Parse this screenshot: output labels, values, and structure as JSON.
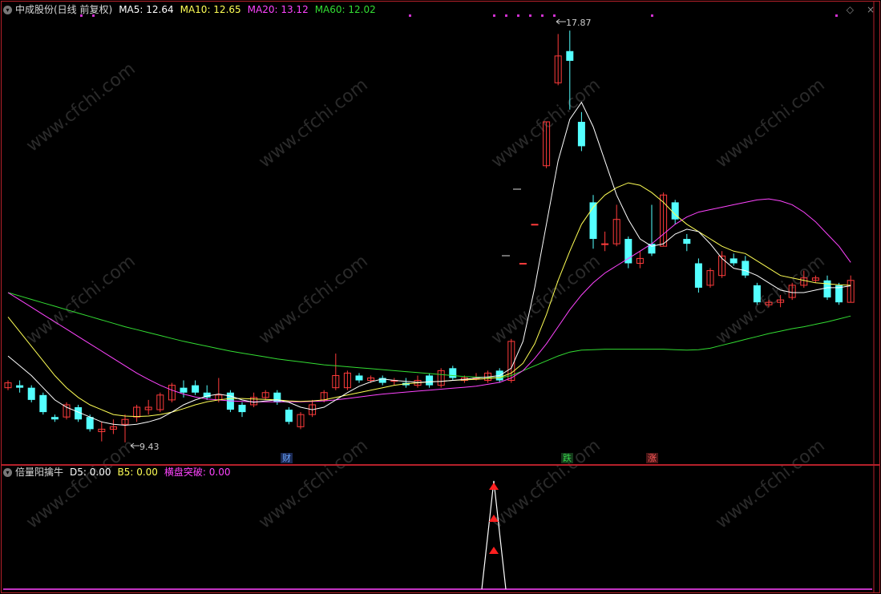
{
  "main_header": {
    "title": "中成股份(日线 前复权)",
    "ma5": "MA5: 12.64",
    "ma10": "MA10: 12.65",
    "ma20": "MA20: 13.12",
    "ma60": "MA60: 12.02"
  },
  "sub_header": {
    "title": "倍量阳擒牛",
    "d5": "D5: 0.00",
    "b5": "B5: 0.00",
    "breakout_label": "横盘突破:",
    "breakout_value": "0.00"
  },
  "annotations": {
    "high": "17.87",
    "low": "9.43"
  },
  "signals": [
    {
      "text": "财",
      "color": "#6aa6ff",
      "bg": "#1b2a55"
    },
    {
      "text": "跌",
      "color": "#36d24a",
      "bg": "#143a1a"
    },
    {
      "text": "涨",
      "color": "#ff5a5a",
      "bg": "#4a1616"
    }
  ],
  "watermark": "www.cfchi.com",
  "colors": {
    "up": "#ff3b3b",
    "down": "#54ffff",
    "ma5": "#ffffff",
    "ma10": "#ffff55",
    "ma20": "#ff44ff",
    "ma60": "#33dd33",
    "grid": "#b4202a"
  },
  "chart_data": {
    "type": "candlestick",
    "price_axis": [
      9.0,
      18.3
    ],
    "candles": [
      [
        10.55,
        10.65,
        10.7,
        10.5
      ],
      [
        10.6,
        10.55,
        10.7,
        10.45
      ],
      [
        10.55,
        10.3,
        10.6,
        10.25
      ],
      [
        10.4,
        10.05,
        10.45,
        10.0
      ],
      [
        9.95,
        9.9,
        10.0,
        9.85
      ],
      [
        9.95,
        10.2,
        10.25,
        9.9
      ],
      [
        10.15,
        9.9,
        10.2,
        9.85
      ],
      [
        9.95,
        9.7,
        10.0,
        9.65
      ],
      [
        9.65,
        9.7,
        9.85,
        9.45
      ],
      [
        9.7,
        9.75,
        9.9,
        9.6
      ],
      [
        9.8,
        9.9,
        10.0,
        9.43
      ],
      [
        9.95,
        10.15,
        10.2,
        9.85
      ],
      [
        10.1,
        10.15,
        10.3,
        10.0
      ],
      [
        10.1,
        10.4,
        10.45,
        10.05
      ],
      [
        10.3,
        10.6,
        10.65,
        10.25
      ],
      [
        10.55,
        10.45,
        10.7,
        10.35
      ],
      [
        10.6,
        10.45,
        10.7,
        10.4
      ],
      [
        10.45,
        10.35,
        10.6,
        10.3
      ],
      [
        10.3,
        10.4,
        10.75,
        10.25
      ],
      [
        10.45,
        10.1,
        10.5,
        10.05
      ],
      [
        10.2,
        10.05,
        10.25,
        9.95
      ],
      [
        10.2,
        10.35,
        10.45,
        10.15
      ],
      [
        10.35,
        10.45,
        10.5,
        10.3
      ],
      [
        10.45,
        10.25,
        10.5,
        10.2
      ],
      [
        10.1,
        9.85,
        10.15,
        9.8
      ],
      [
        9.75,
        10.0,
        10.05,
        9.7
      ],
      [
        10.0,
        10.2,
        10.3,
        9.95
      ],
      [
        10.3,
        10.45,
        10.5,
        10.25
      ],
      [
        10.55,
        10.8,
        11.25,
        10.5
      ],
      [
        10.55,
        10.85,
        10.9,
        10.5
      ],
      [
        10.8,
        10.7,
        10.85,
        10.65
      ],
      [
        10.7,
        10.75,
        10.8,
        10.65
      ],
      [
        10.75,
        10.65,
        10.8,
        10.6
      ],
      [
        10.7,
        10.7,
        10.75,
        10.6
      ],
      [
        10.65,
        10.6,
        10.75,
        10.55
      ],
      [
        10.6,
        10.7,
        10.8,
        10.55
      ],
      [
        10.8,
        10.6,
        10.85,
        10.55
      ],
      [
        10.6,
        10.9,
        10.95,
        10.55
      ],
      [
        10.95,
        10.75,
        11.0,
        10.7
      ],
      [
        10.7,
        10.75,
        10.8,
        10.65
      ],
      [
        10.75,
        10.75,
        10.85,
        10.7
      ],
      [
        10.7,
        10.85,
        10.9,
        10.65
      ],
      [
        10.9,
        10.7,
        10.95,
        10.65
      ],
      [
        10.7,
        11.5,
        11.55,
        10.65
      ],
      [
        13.1,
        13.1,
        13.1,
        13.1
      ],
      [
        13.9,
        13.9,
        13.9,
        13.9
      ],
      [
        15.1,
        16.0,
        16.0,
        15.05
      ],
      [
        16.8,
        17.35,
        17.8,
        16.75
      ],
      [
        17.45,
        17.25,
        17.87,
        16.25
      ],
      [
        16.0,
        15.5,
        16.2,
        15.4
      ],
      [
        14.35,
        13.6,
        14.5,
        13.4
      ],
      [
        13.5,
        13.5,
        13.75,
        13.35
      ],
      [
        13.5,
        14.0,
        14.3,
        13.45
      ],
      [
        13.6,
        13.1,
        13.65,
        13.0
      ],
      [
        13.1,
        13.2,
        13.35,
        13.0
      ],
      [
        13.5,
        13.3,
        14.3,
        13.25
      ],
      [
        13.45,
        14.5,
        14.55,
        13.45
      ],
      [
        14.35,
        14.0,
        14.4,
        13.9
      ],
      [
        13.6,
        13.5,
        13.7,
        13.35
      ],
      [
        13.1,
        12.6,
        13.2,
        12.5
      ],
      [
        12.65,
        12.95,
        13.0,
        12.6
      ],
      [
        12.85,
        13.25,
        13.35,
        12.8
      ],
      [
        13.2,
        13.1,
        13.3,
        13.05
      ],
      [
        13.15,
        12.85,
        13.25,
        12.8
      ],
      [
        12.65,
        12.3,
        12.7,
        12.25
      ],
      [
        12.25,
        12.3,
        12.35,
        12.2
      ],
      [
        12.3,
        12.35,
        12.45,
        12.2
      ],
      [
        12.4,
        12.65,
        12.7,
        12.35
      ],
      [
        12.65,
        12.8,
        12.95,
        12.6
      ],
      [
        12.75,
        12.8,
        12.85,
        12.7
      ],
      [
        12.75,
        12.4,
        12.85,
        12.35
      ],
      [
        12.65,
        12.3,
        12.7,
        12.25
      ],
      [
        12.3,
        12.75,
        12.85,
        12.3
      ]
    ],
    "ma5": [
      11.2,
      11.0,
      10.8,
      10.55,
      10.3,
      10.15,
      10.05,
      9.95,
      9.85,
      9.8,
      9.78,
      9.8,
      9.85,
      9.92,
      10.05,
      10.2,
      10.3,
      10.38,
      10.42,
      10.38,
      10.3,
      10.25,
      10.28,
      10.3,
      10.25,
      10.15,
      10.1,
      10.15,
      10.3,
      10.45,
      10.58,
      10.67,
      10.73,
      10.7,
      10.68,
      10.66,
      10.67,
      10.68,
      10.7,
      10.72,
      10.75,
      10.77,
      10.8,
      10.95,
      11.5,
      12.6,
      13.9,
      15.2,
      16.05,
      16.4,
      15.9,
      15.2,
      14.5,
      14.0,
      13.6,
      13.45,
      13.5,
      13.7,
      13.8,
      13.75,
      13.5,
      13.2,
      13.0,
      12.95,
      12.85,
      12.7,
      12.55,
      12.5,
      12.5,
      12.55,
      12.6,
      12.6,
      12.64
    ],
    "ma10": [
      12.0,
      11.7,
      11.4,
      11.1,
      10.8,
      10.55,
      10.35,
      10.2,
      10.1,
      10.0,
      9.97,
      9.96,
      9.97,
      10.0,
      10.05,
      10.12,
      10.2,
      10.26,
      10.3,
      10.33,
      10.33,
      10.32,
      10.31,
      10.3,
      10.28,
      10.27,
      10.28,
      10.3,
      10.35,
      10.4,
      10.45,
      10.5,
      10.55,
      10.6,
      10.63,
      10.65,
      10.67,
      10.68,
      10.7,
      10.71,
      10.72,
      10.74,
      10.76,
      10.85,
      11.05,
      11.45,
      12.05,
      12.75,
      13.35,
      13.9,
      14.25,
      14.5,
      14.65,
      14.75,
      14.7,
      14.55,
      14.35,
      14.1,
      13.9,
      13.75,
      13.6,
      13.45,
      13.35,
      13.3,
      13.15,
      13.0,
      12.85,
      12.8,
      12.75,
      12.7,
      12.68,
      12.66,
      12.65
    ],
    "ma20": [
      12.5,
      12.35,
      12.2,
      12.05,
      11.9,
      11.75,
      11.6,
      11.45,
      11.3,
      11.15,
      11.0,
      10.85,
      10.72,
      10.6,
      10.5,
      10.42,
      10.36,
      10.32,
      10.3,
      10.28,
      10.27,
      10.26,
      10.26,
      10.26,
      10.26,
      10.26,
      10.27,
      10.28,
      10.3,
      10.33,
      10.36,
      10.39,
      10.42,
      10.44,
      10.46,
      10.48,
      10.5,
      10.52,
      10.54,
      10.56,
      10.58,
      10.62,
      10.66,
      10.75,
      10.9,
      11.15,
      11.45,
      11.8,
      12.15,
      12.45,
      12.7,
      12.9,
      13.05,
      13.2,
      13.35,
      13.5,
      13.7,
      13.9,
      14.05,
      14.15,
      14.2,
      14.25,
      14.3,
      14.35,
      14.4,
      14.42,
      14.38,
      14.3,
      14.15,
      13.95,
      13.7,
      13.45,
      13.12
    ],
    "ma60": [
      12.5,
      12.43,
      12.36,
      12.29,
      12.22,
      12.15,
      12.08,
      12.01,
      11.94,
      11.87,
      11.8,
      11.74,
      11.68,
      11.62,
      11.56,
      11.5,
      11.45,
      11.4,
      11.35,
      11.3,
      11.26,
      11.22,
      11.18,
      11.14,
      11.11,
      11.08,
      11.05,
      11.02,
      11.0,
      10.98,
      10.96,
      10.94,
      10.92,
      10.9,
      10.88,
      10.86,
      10.84,
      10.82,
      10.8,
      10.78,
      10.77,
      10.76,
      10.75,
      10.8,
      10.9,
      11.0,
      11.1,
      11.2,
      11.28,
      11.32,
      11.33,
      11.34,
      11.34,
      11.34,
      11.34,
      11.34,
      11.34,
      11.33,
      11.32,
      11.33,
      11.36,
      11.42,
      11.48,
      11.54,
      11.6,
      11.66,
      11.71,
      11.76,
      11.8,
      11.85,
      11.9,
      11.96,
      12.02
    ]
  }
}
